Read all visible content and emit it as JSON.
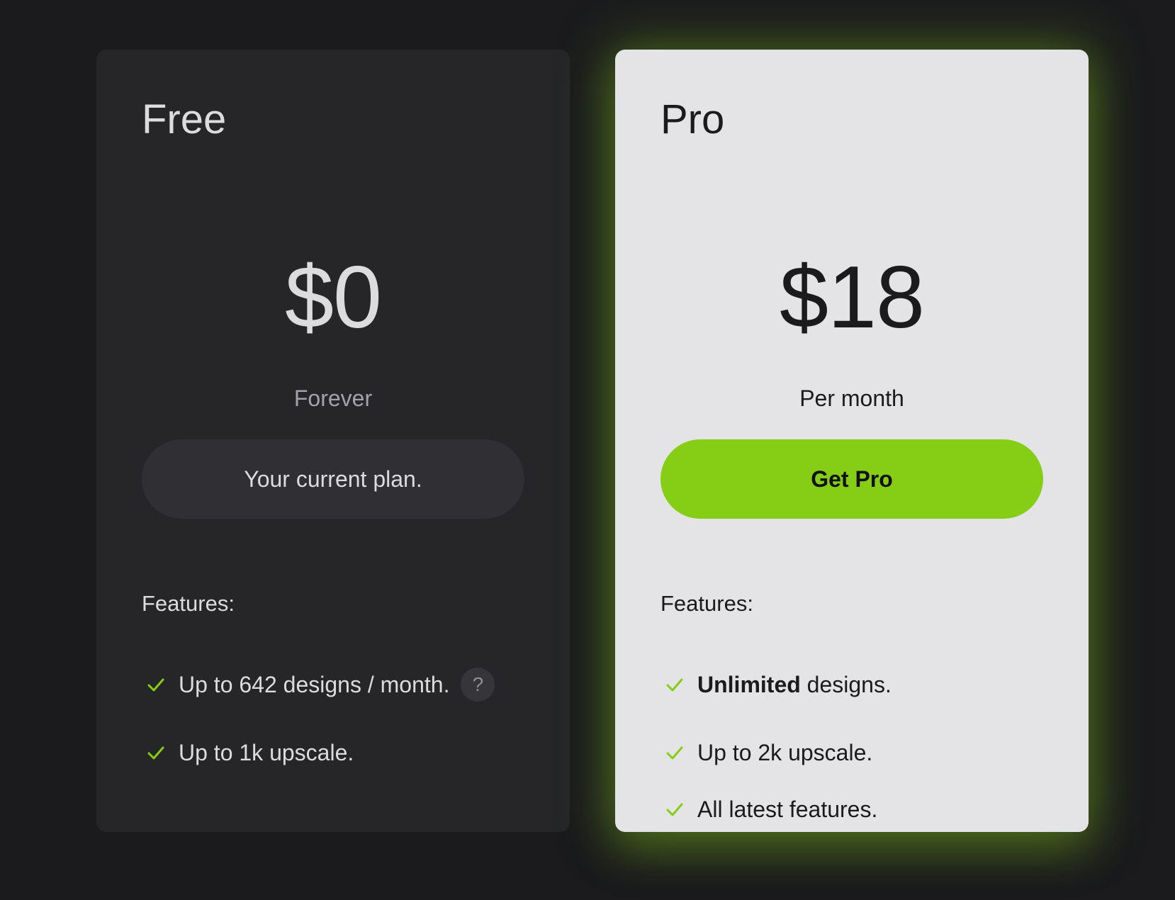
{
  "colors": {
    "background": "#1b1b1d",
    "free_card": "#262628",
    "pro_card": "#e4e4e6",
    "accent": "#86cd16",
    "check": "#86cd16"
  },
  "plans": {
    "free": {
      "name": "Free",
      "price": "$0",
      "period": "Forever",
      "button_label": "Your current plan.",
      "features_label": "Features:",
      "features": [
        {
          "text": "Up to 642 designs / month.",
          "icon": "check-icon",
          "help_icon": "?"
        },
        {
          "text": "Up to 1k upscale.",
          "icon": "check-icon"
        }
      ]
    },
    "pro": {
      "name": "Pro",
      "price": "$18",
      "period": "Per month",
      "button_label": "Get Pro",
      "features_label": "Features:",
      "features": [
        {
          "bold": "Unlimited",
          "text": " designs.",
          "icon": "check-icon"
        },
        {
          "text": "Up to 2k upscale.",
          "icon": "check-icon"
        },
        {
          "text": "All latest features.",
          "icon": "check-icon"
        }
      ]
    }
  }
}
